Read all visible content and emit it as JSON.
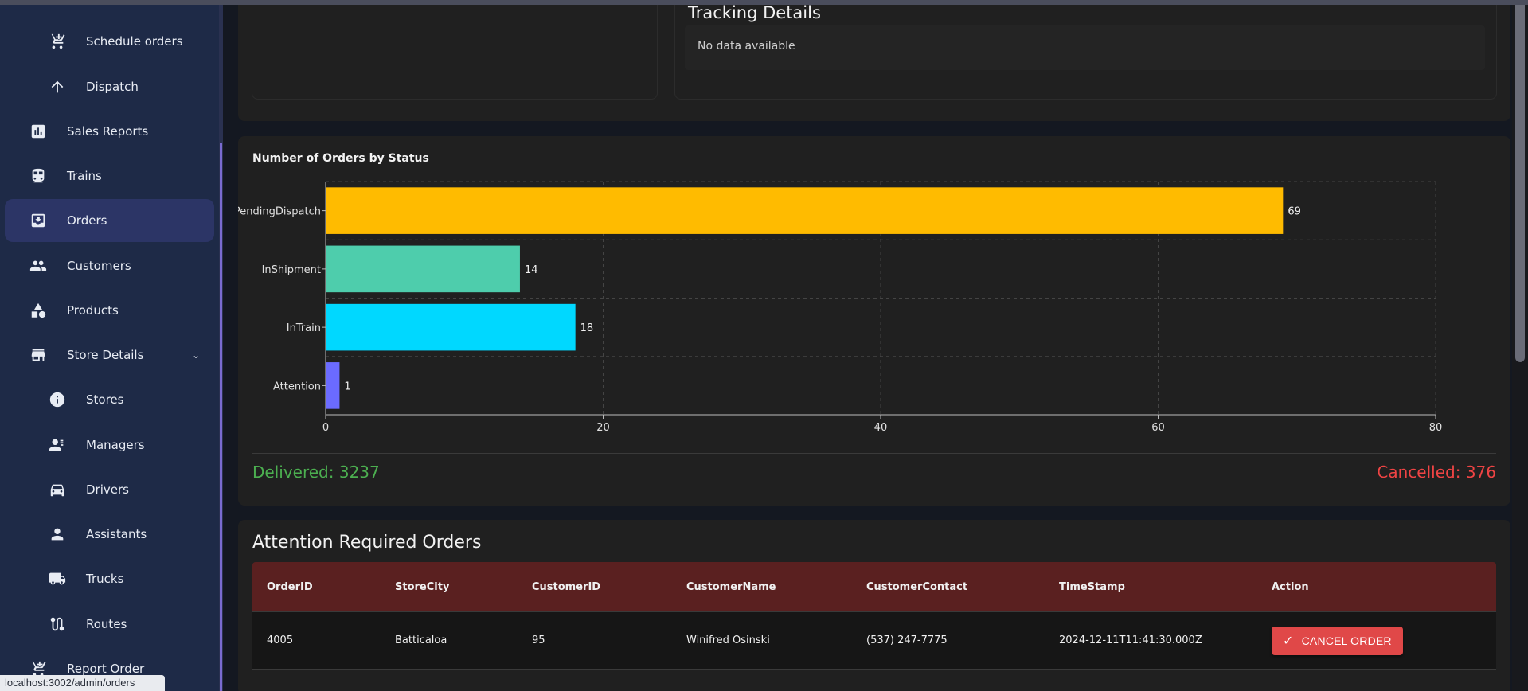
{
  "sidebar": {
    "items": [
      {
        "label": "Schedule orders",
        "icon": "cart-add-icon",
        "sub": true
      },
      {
        "label": "Dispatch",
        "icon": "arrow-up-icon",
        "sub": true
      },
      {
        "label": "Sales Reports",
        "icon": "bar-chart-icon",
        "sub": false
      },
      {
        "label": "Trains",
        "icon": "train-icon",
        "sub": false
      },
      {
        "label": "Orders",
        "icon": "inbox-icon",
        "sub": false,
        "active": true
      },
      {
        "label": "Customers",
        "icon": "people-icon",
        "sub": false
      },
      {
        "label": "Products",
        "icon": "shapes-icon",
        "sub": false
      },
      {
        "label": "Store Details",
        "icon": "store-icon",
        "sub": false,
        "expandable": true
      },
      {
        "label": "Stores",
        "icon": "info-icon",
        "sub": true
      },
      {
        "label": "Managers",
        "icon": "manager-icon",
        "sub": true
      },
      {
        "label": "Drivers",
        "icon": "car-icon",
        "sub": true
      },
      {
        "label": "Assistants",
        "icon": "person-icon",
        "sub": true
      },
      {
        "label": "Trucks",
        "icon": "truck-icon",
        "sub": true
      },
      {
        "label": "Routes",
        "icon": "route-icon",
        "sub": true
      },
      {
        "label": "Report Order",
        "icon": "cart-add-icon",
        "sub": false
      }
    ]
  },
  "status_url": "localhost:3002/admin/orders",
  "tracking": {
    "title": "Tracking Details",
    "empty_text": "No data available"
  },
  "chart_data": {
    "type": "bar",
    "orientation": "horizontal",
    "title": "Number of Orders by Status",
    "categories": [
      "PendingDispatch",
      "InShipment",
      "InTrain",
      "Attention"
    ],
    "values": [
      69,
      14,
      18,
      1
    ],
    "colors": [
      "#ffbb00",
      "#4ecdac",
      "#00d8ff",
      "#6b6bff"
    ],
    "xlim": [
      0,
      80
    ],
    "xticks": [
      0,
      20,
      40,
      60,
      80
    ],
    "grid": true,
    "xlabel": "",
    "ylabel": ""
  },
  "summary": {
    "delivered": "Delivered: 3237",
    "cancelled": "Cancelled: 376",
    "delivered_color": "#4caf50",
    "cancelled_color": "#ef4444"
  },
  "attention": {
    "title": "Attention Required Orders",
    "columns": [
      "OrderID",
      "StoreCity",
      "CustomerID",
      "CustomerName",
      "CustomerContact",
      "TimeStamp",
      "Action"
    ],
    "rows": [
      [
        "4005",
        "Batticaloa",
        "95",
        "Winifred Osinski",
        "(537) 247-7775",
        "2024-12-11T11:41:30.000Z"
      ]
    ],
    "action_label": "CANCEL ORDER",
    "header_color": "#5a2020",
    "button_color": "#e04848"
  }
}
